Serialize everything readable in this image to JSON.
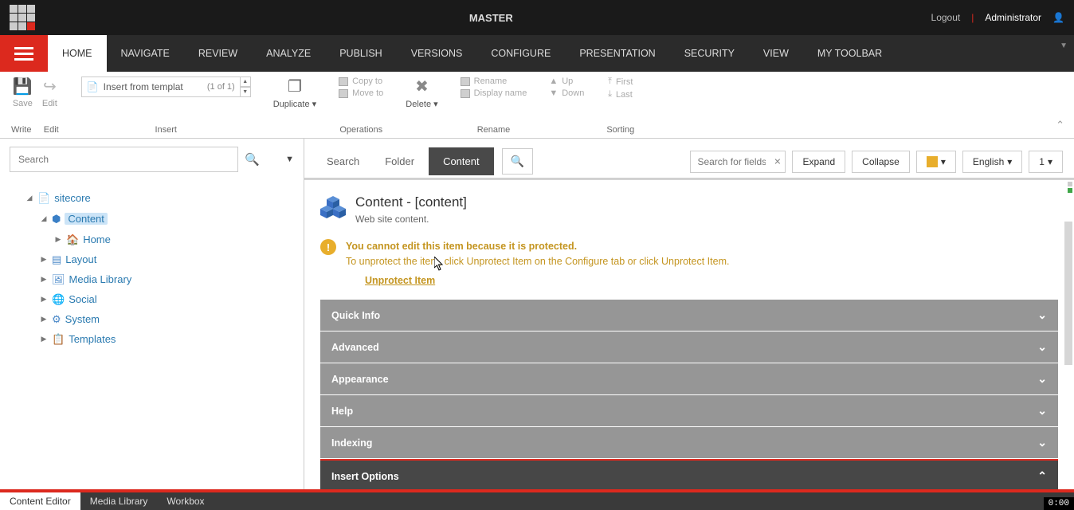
{
  "topbar": {
    "title": "MASTER",
    "logout": "Logout",
    "user": "Administrator"
  },
  "nav": {
    "tabs": [
      "HOME",
      "NAVIGATE",
      "REVIEW",
      "ANALYZE",
      "PUBLISH",
      "VERSIONS",
      "CONFIGURE",
      "PRESENTATION",
      "SECURITY",
      "VIEW",
      "MY TOOLBAR"
    ],
    "active": "HOME"
  },
  "ribbon": {
    "write": {
      "save": "Save",
      "edit": "Edit",
      "label": "Write",
      "edit2": "Edit"
    },
    "insert": {
      "box_text": "Insert from templat",
      "page": "(1 of 1)",
      "label": "Insert"
    },
    "duplicate": "Duplicate",
    "operations": {
      "copy": "Copy to",
      "move": "Move to",
      "label": "Operations"
    },
    "delete": "Delete",
    "rename": {
      "rename": "Rename",
      "display": "Display name",
      "label": "Rename"
    },
    "move_sort": {
      "up": "Up",
      "down": "Down",
      "first": "First",
      "last": "Last",
      "label": "Sorting"
    }
  },
  "search": {
    "placeholder": "Search"
  },
  "tree": {
    "root": "sitecore",
    "content": "Content",
    "home": "Home",
    "layout": "Layout",
    "media": "Media Library",
    "social": "Social",
    "system": "System",
    "templates": "Templates"
  },
  "right_tabs": {
    "search": "Search",
    "folder": "Folder",
    "content": "Content",
    "fields_placeholder": "Search for fields",
    "expand": "Expand",
    "collapse": "Collapse",
    "language": "English",
    "version": "1"
  },
  "item": {
    "title": "Content - [content]",
    "subtitle": "Web site content.",
    "warn1": "You cannot edit this item because it is protected.",
    "warn2": "To unprotect the item, click Unprotect Item on the Configure tab or click Unprotect Item.",
    "unprotect": "Unprotect Item"
  },
  "sections": [
    "Quick Info",
    "Advanced",
    "Appearance",
    "Help",
    "Indexing",
    "Insert Options"
  ],
  "bottom": {
    "tabs": [
      "Content Editor",
      "Media Library",
      "Workbox"
    ],
    "timer": "0:00"
  }
}
